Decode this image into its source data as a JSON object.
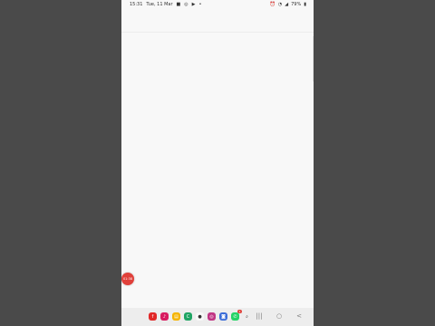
{
  "status_bar": {
    "time": "15:31",
    "date": "Tue, 11 Mar",
    "left_icons": [
      "chat-icon",
      "instagram-icon",
      "youtube-icon",
      "dot-icon"
    ],
    "right_icons": [
      "alarm-icon",
      "wifi-icon",
      "signal-icon"
    ],
    "battery": "79%"
  },
  "recording": {
    "label": "01:38"
  },
  "dock": {
    "apps": [
      {
        "name": "flipboard",
        "color": "#e12828",
        "glyph": "f"
      },
      {
        "name": "music",
        "color": "#d81b60",
        "glyph": "♪"
      },
      {
        "name": "files",
        "color": "#f5b400",
        "glyph": "▤"
      },
      {
        "name": "ccleaner",
        "color": "#1fa463",
        "glyph": "C"
      },
      {
        "name": "messages",
        "color": "#f8f8f8",
        "glyph": "●"
      },
      {
        "name": "instagram",
        "color": "#c13584",
        "glyph": "◎"
      },
      {
        "name": "gallery",
        "color": "#3b6dd8",
        "glyph": "◙"
      },
      {
        "name": "whatsapp",
        "color": "#25d366",
        "glyph": "✆",
        "badge": "1"
      },
      {
        "name": "search",
        "color": "#ededed",
        "glyph": "⌕"
      }
    ]
  },
  "nav": {
    "recents": "|||",
    "home": "○",
    "back": "<"
  }
}
